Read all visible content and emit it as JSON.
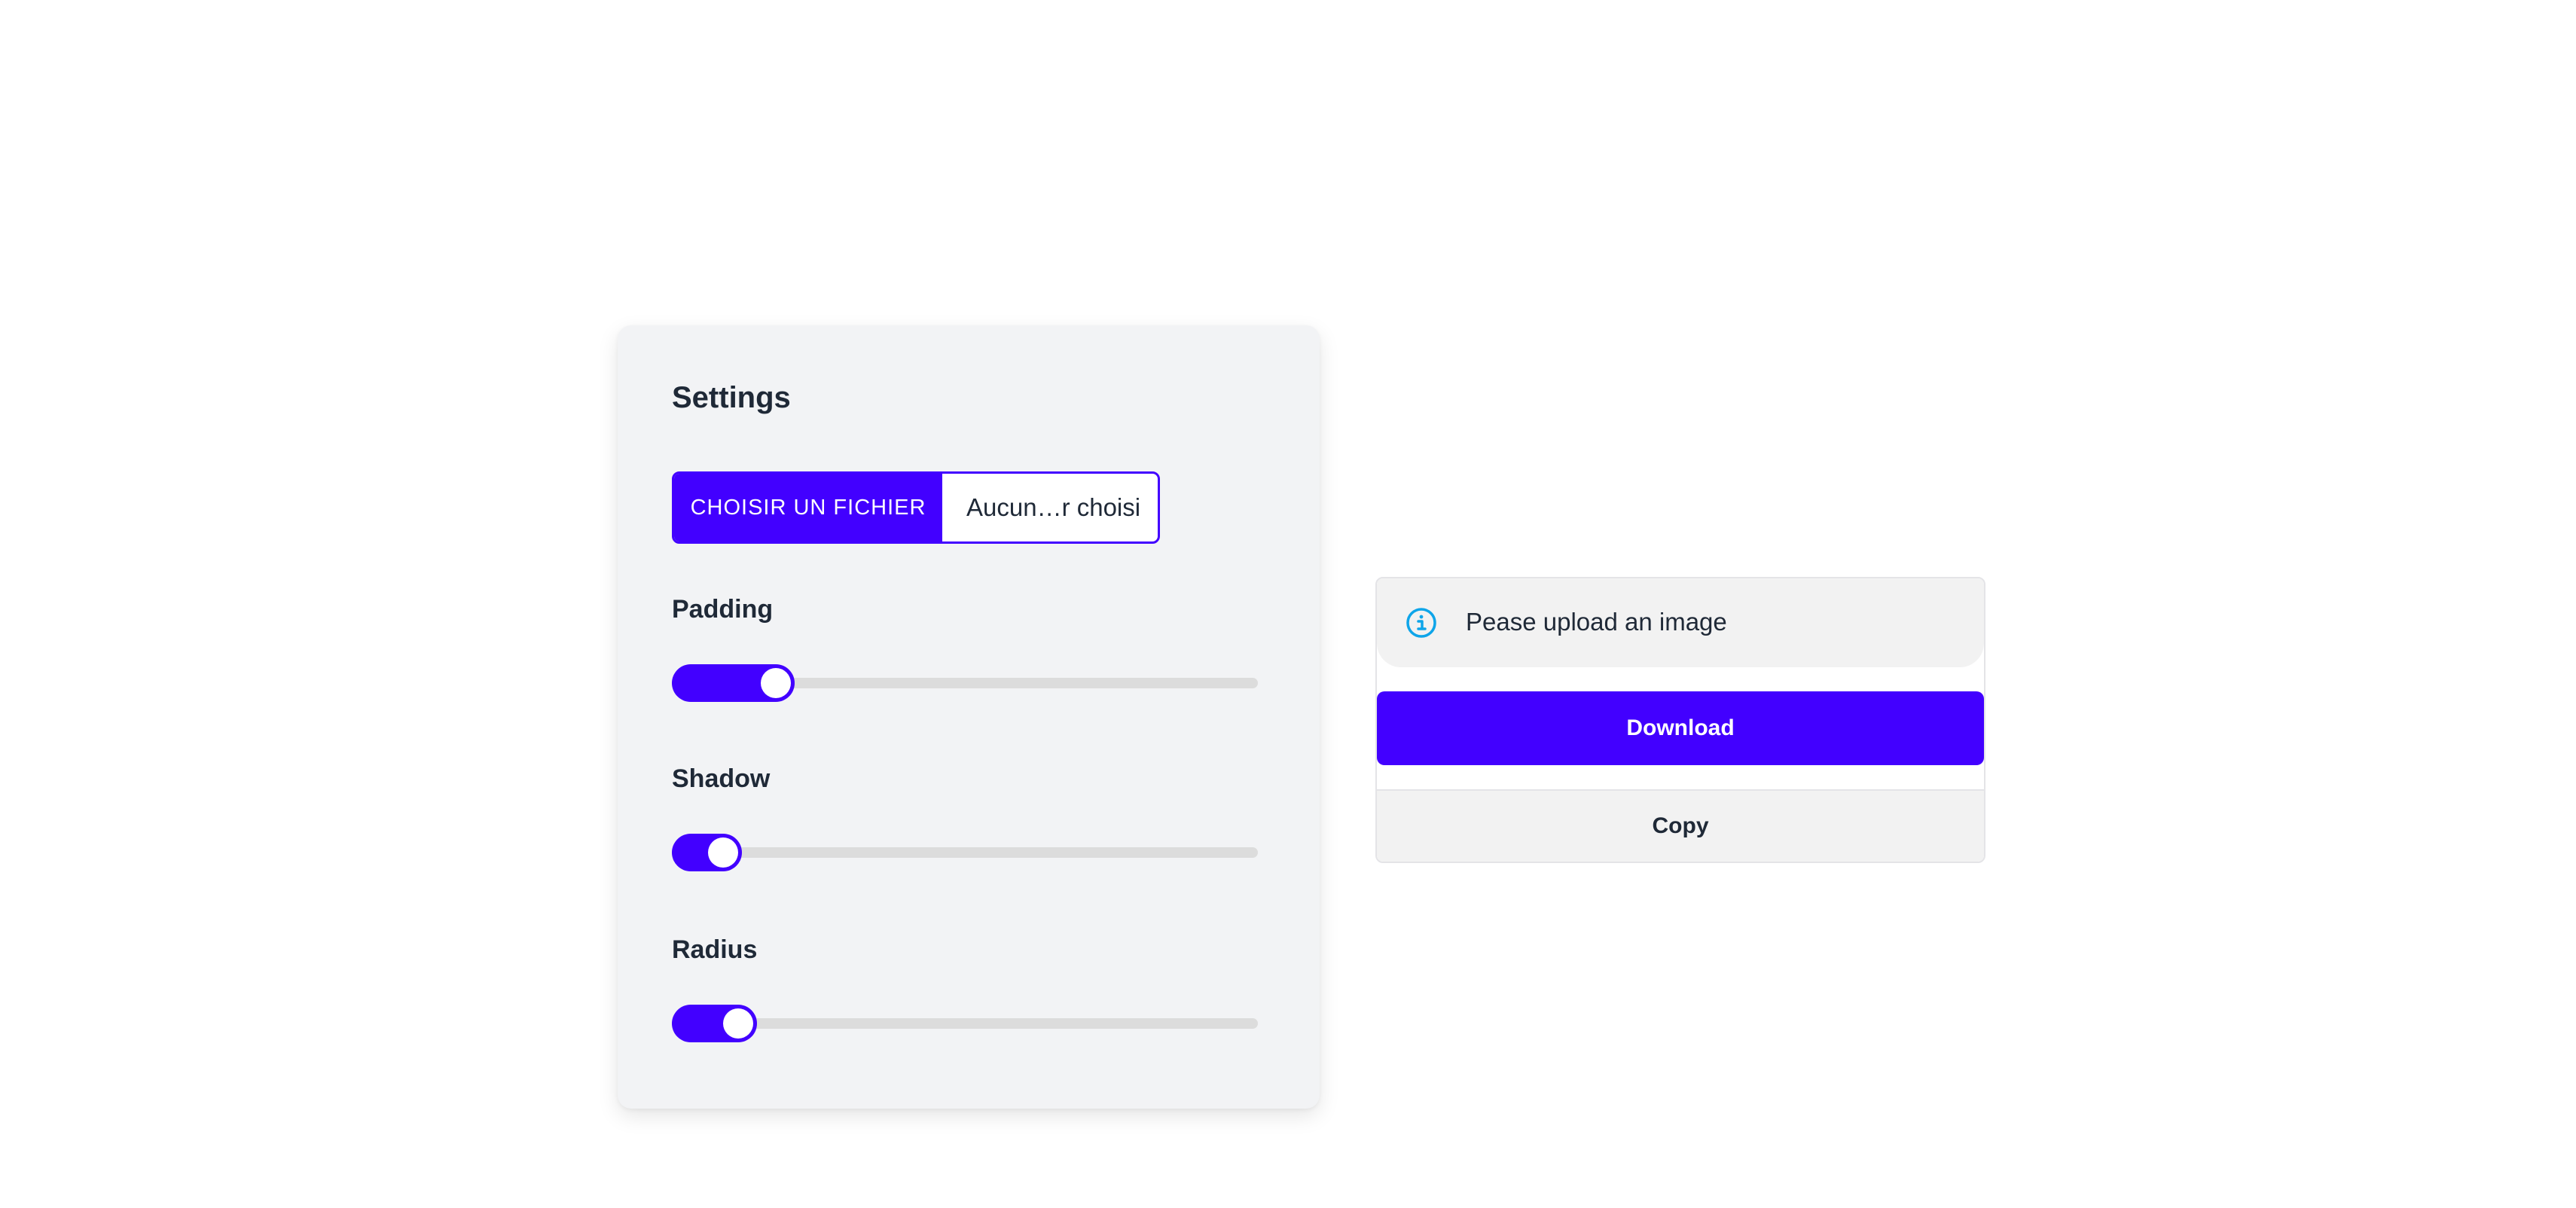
{
  "settings": {
    "title": "Settings",
    "file_input": {
      "button_label": "CHOISIR UN FICHIER",
      "file_name": "Aucun…r choisi"
    },
    "sliders": [
      {
        "id": "padding",
        "label": "Padding",
        "value_fraction": 0.21
      },
      {
        "id": "shadow",
        "label": "Shadow",
        "value_fraction": 0.12
      },
      {
        "id": "radius",
        "label": "Radius",
        "value_fraction": 0.145
      }
    ]
  },
  "output": {
    "alert_text": "Pease upload an image",
    "alert_icon": "info-circle-icon",
    "download_label": "Download",
    "copy_label": "Copy"
  },
  "colors": {
    "accent": "#4200ff",
    "info": "#0ea5e9",
    "card_bg": "#f2f3f5",
    "track": "#dcdcdc"
  }
}
